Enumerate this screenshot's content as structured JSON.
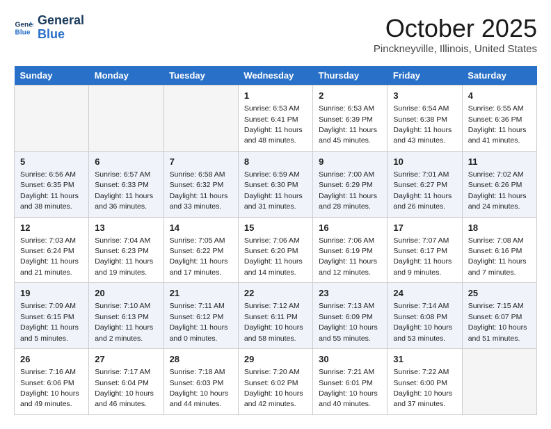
{
  "header": {
    "logo_line1": "General",
    "logo_line2": "Blue",
    "month": "October 2025",
    "location": "Pinckneyville, Illinois, United States"
  },
  "days_of_week": [
    "Sunday",
    "Monday",
    "Tuesday",
    "Wednesday",
    "Thursday",
    "Friday",
    "Saturday"
  ],
  "weeks": [
    [
      {
        "num": "",
        "info": ""
      },
      {
        "num": "",
        "info": ""
      },
      {
        "num": "",
        "info": ""
      },
      {
        "num": "1",
        "info": "Sunrise: 6:53 AM\nSunset: 6:41 PM\nDaylight: 11 hours and 48 minutes."
      },
      {
        "num": "2",
        "info": "Sunrise: 6:53 AM\nSunset: 6:39 PM\nDaylight: 11 hours and 45 minutes."
      },
      {
        "num": "3",
        "info": "Sunrise: 6:54 AM\nSunset: 6:38 PM\nDaylight: 11 hours and 43 minutes."
      },
      {
        "num": "4",
        "info": "Sunrise: 6:55 AM\nSunset: 6:36 PM\nDaylight: 11 hours and 41 minutes."
      }
    ],
    [
      {
        "num": "5",
        "info": "Sunrise: 6:56 AM\nSunset: 6:35 PM\nDaylight: 11 hours and 38 minutes."
      },
      {
        "num": "6",
        "info": "Sunrise: 6:57 AM\nSunset: 6:33 PM\nDaylight: 11 hours and 36 minutes."
      },
      {
        "num": "7",
        "info": "Sunrise: 6:58 AM\nSunset: 6:32 PM\nDaylight: 11 hours and 33 minutes."
      },
      {
        "num": "8",
        "info": "Sunrise: 6:59 AM\nSunset: 6:30 PM\nDaylight: 11 hours and 31 minutes."
      },
      {
        "num": "9",
        "info": "Sunrise: 7:00 AM\nSunset: 6:29 PM\nDaylight: 11 hours and 28 minutes."
      },
      {
        "num": "10",
        "info": "Sunrise: 7:01 AM\nSunset: 6:27 PM\nDaylight: 11 hours and 26 minutes."
      },
      {
        "num": "11",
        "info": "Sunrise: 7:02 AM\nSunset: 6:26 PM\nDaylight: 11 hours and 24 minutes."
      }
    ],
    [
      {
        "num": "12",
        "info": "Sunrise: 7:03 AM\nSunset: 6:24 PM\nDaylight: 11 hours and 21 minutes."
      },
      {
        "num": "13",
        "info": "Sunrise: 7:04 AM\nSunset: 6:23 PM\nDaylight: 11 hours and 19 minutes."
      },
      {
        "num": "14",
        "info": "Sunrise: 7:05 AM\nSunset: 6:22 PM\nDaylight: 11 hours and 17 minutes."
      },
      {
        "num": "15",
        "info": "Sunrise: 7:06 AM\nSunset: 6:20 PM\nDaylight: 11 hours and 14 minutes."
      },
      {
        "num": "16",
        "info": "Sunrise: 7:06 AM\nSunset: 6:19 PM\nDaylight: 11 hours and 12 minutes."
      },
      {
        "num": "17",
        "info": "Sunrise: 7:07 AM\nSunset: 6:17 PM\nDaylight: 11 hours and 9 minutes."
      },
      {
        "num": "18",
        "info": "Sunrise: 7:08 AM\nSunset: 6:16 PM\nDaylight: 11 hours and 7 minutes."
      }
    ],
    [
      {
        "num": "19",
        "info": "Sunrise: 7:09 AM\nSunset: 6:15 PM\nDaylight: 11 hours and 5 minutes."
      },
      {
        "num": "20",
        "info": "Sunrise: 7:10 AM\nSunset: 6:13 PM\nDaylight: 11 hours and 2 minutes."
      },
      {
        "num": "21",
        "info": "Sunrise: 7:11 AM\nSunset: 6:12 PM\nDaylight: 11 hours and 0 minutes."
      },
      {
        "num": "22",
        "info": "Sunrise: 7:12 AM\nSunset: 6:11 PM\nDaylight: 10 hours and 58 minutes."
      },
      {
        "num": "23",
        "info": "Sunrise: 7:13 AM\nSunset: 6:09 PM\nDaylight: 10 hours and 55 minutes."
      },
      {
        "num": "24",
        "info": "Sunrise: 7:14 AM\nSunset: 6:08 PM\nDaylight: 10 hours and 53 minutes."
      },
      {
        "num": "25",
        "info": "Sunrise: 7:15 AM\nSunset: 6:07 PM\nDaylight: 10 hours and 51 minutes."
      }
    ],
    [
      {
        "num": "26",
        "info": "Sunrise: 7:16 AM\nSunset: 6:06 PM\nDaylight: 10 hours and 49 minutes."
      },
      {
        "num": "27",
        "info": "Sunrise: 7:17 AM\nSunset: 6:04 PM\nDaylight: 10 hours and 46 minutes."
      },
      {
        "num": "28",
        "info": "Sunrise: 7:18 AM\nSunset: 6:03 PM\nDaylight: 10 hours and 44 minutes."
      },
      {
        "num": "29",
        "info": "Sunrise: 7:20 AM\nSunset: 6:02 PM\nDaylight: 10 hours and 42 minutes."
      },
      {
        "num": "30",
        "info": "Sunrise: 7:21 AM\nSunset: 6:01 PM\nDaylight: 10 hours and 40 minutes."
      },
      {
        "num": "31",
        "info": "Sunrise: 7:22 AM\nSunset: 6:00 PM\nDaylight: 10 hours and 37 minutes."
      },
      {
        "num": "",
        "info": ""
      }
    ]
  ]
}
